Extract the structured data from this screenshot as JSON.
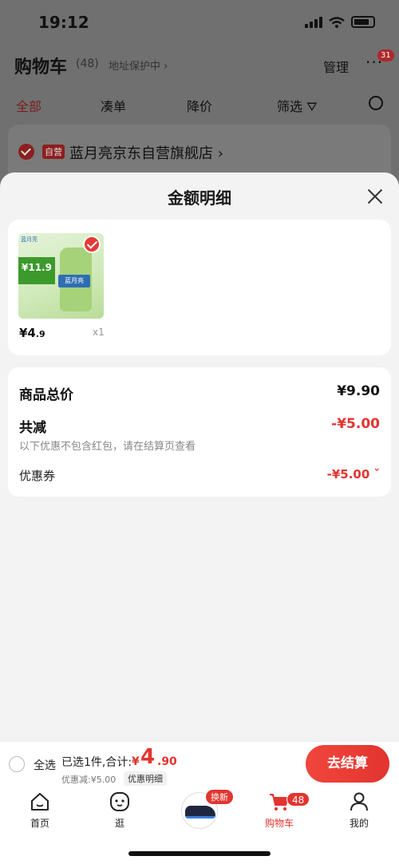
{
  "status": {
    "time": "19:12"
  },
  "cart": {
    "title": "购物车",
    "count": "(48)",
    "address_protect": "地址保护中 ›",
    "manage": "管理",
    "more_badge": "31",
    "filters": [
      "全部",
      "凑单",
      "降价",
      "筛选"
    ],
    "store": {
      "tag": "自营",
      "name": "蓝月亮京东自营旗舰店 ›"
    }
  },
  "sheet": {
    "title": "金额明细",
    "product": {
      "image_label_logo": "蓝月亮",
      "image_label_price": "¥11.9",
      "image_label_brand": "蓝月亮",
      "price_int": "¥4",
      "price_dec": ".9",
      "qty": "x1"
    },
    "summary": {
      "total_label": "商品总价",
      "total_value": "¥9.90",
      "reduce_label": "共减",
      "reduce_value": "-¥5.00",
      "note": "以下优惠不包含红包，请在结算页查看",
      "coupon_label": "优惠券",
      "coupon_value": "-¥5.00 ˇ"
    }
  },
  "checkout": {
    "select_all": "全选",
    "selected_text": "已选1件,合计:",
    "yen": "¥",
    "total_int": "4",
    "total_dec": ".90",
    "discount": "优惠减:¥5.00",
    "detail": "优惠明细",
    "button": "去结算"
  },
  "tabs": {
    "home": "首页",
    "browse": "逛",
    "promo_tag": "换新",
    "cart": "购物车",
    "cart_badge": "48",
    "mine": "我的"
  },
  "colors": {
    "accent": "#e3342f",
    "sheet_bg": "#f3f3f3"
  }
}
